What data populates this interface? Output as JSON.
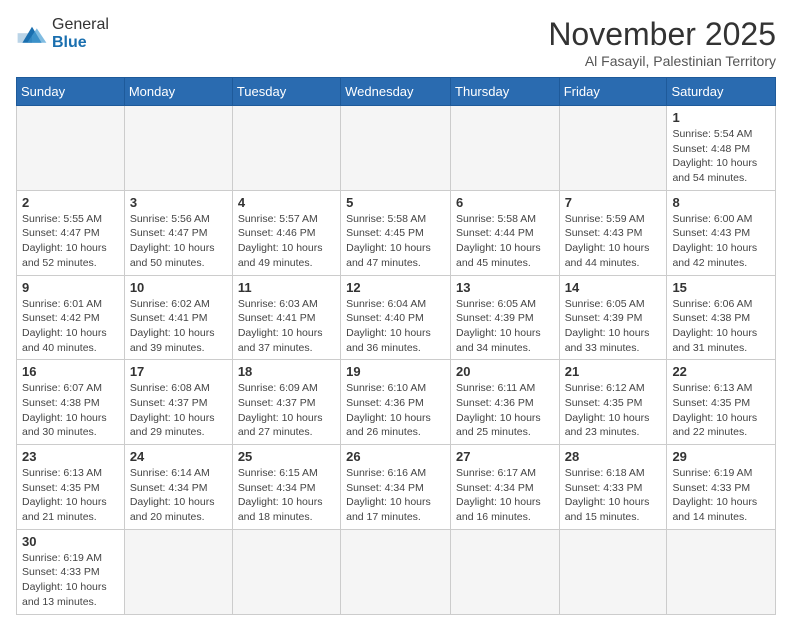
{
  "header": {
    "logo_general": "General",
    "logo_blue": "Blue",
    "month_title": "November 2025",
    "subtitle": "Al Fasayil, Palestinian Territory"
  },
  "weekdays": [
    "Sunday",
    "Monday",
    "Tuesday",
    "Wednesday",
    "Thursday",
    "Friday",
    "Saturday"
  ],
  "days": {
    "d1": {
      "n": "1",
      "info": "Sunrise: 5:54 AM\nSunset: 4:48 PM\nDaylight: 10 hours\nand 54 minutes."
    },
    "d2": {
      "n": "2",
      "info": "Sunrise: 5:55 AM\nSunset: 4:47 PM\nDaylight: 10 hours\nand 52 minutes."
    },
    "d3": {
      "n": "3",
      "info": "Sunrise: 5:56 AM\nSunset: 4:47 PM\nDaylight: 10 hours\nand 50 minutes."
    },
    "d4": {
      "n": "4",
      "info": "Sunrise: 5:57 AM\nSunset: 4:46 PM\nDaylight: 10 hours\nand 49 minutes."
    },
    "d5": {
      "n": "5",
      "info": "Sunrise: 5:58 AM\nSunset: 4:45 PM\nDaylight: 10 hours\nand 47 minutes."
    },
    "d6": {
      "n": "6",
      "info": "Sunrise: 5:58 AM\nSunset: 4:44 PM\nDaylight: 10 hours\nand 45 minutes."
    },
    "d7": {
      "n": "7",
      "info": "Sunrise: 5:59 AM\nSunset: 4:43 PM\nDaylight: 10 hours\nand 44 minutes."
    },
    "d8": {
      "n": "8",
      "info": "Sunrise: 6:00 AM\nSunset: 4:43 PM\nDaylight: 10 hours\nand 42 minutes."
    },
    "d9": {
      "n": "9",
      "info": "Sunrise: 6:01 AM\nSunset: 4:42 PM\nDaylight: 10 hours\nand 40 minutes."
    },
    "d10": {
      "n": "10",
      "info": "Sunrise: 6:02 AM\nSunset: 4:41 PM\nDaylight: 10 hours\nand 39 minutes."
    },
    "d11": {
      "n": "11",
      "info": "Sunrise: 6:03 AM\nSunset: 4:41 PM\nDaylight: 10 hours\nand 37 minutes."
    },
    "d12": {
      "n": "12",
      "info": "Sunrise: 6:04 AM\nSunset: 4:40 PM\nDaylight: 10 hours\nand 36 minutes."
    },
    "d13": {
      "n": "13",
      "info": "Sunrise: 6:05 AM\nSunset: 4:39 PM\nDaylight: 10 hours\nand 34 minutes."
    },
    "d14": {
      "n": "14",
      "info": "Sunrise: 6:05 AM\nSunset: 4:39 PM\nDaylight: 10 hours\nand 33 minutes."
    },
    "d15": {
      "n": "15",
      "info": "Sunrise: 6:06 AM\nSunset: 4:38 PM\nDaylight: 10 hours\nand 31 minutes."
    },
    "d16": {
      "n": "16",
      "info": "Sunrise: 6:07 AM\nSunset: 4:38 PM\nDaylight: 10 hours\nand 30 minutes."
    },
    "d17": {
      "n": "17",
      "info": "Sunrise: 6:08 AM\nSunset: 4:37 PM\nDaylight: 10 hours\nand 29 minutes."
    },
    "d18": {
      "n": "18",
      "info": "Sunrise: 6:09 AM\nSunset: 4:37 PM\nDaylight: 10 hours\nand 27 minutes."
    },
    "d19": {
      "n": "19",
      "info": "Sunrise: 6:10 AM\nSunset: 4:36 PM\nDaylight: 10 hours\nand 26 minutes."
    },
    "d20": {
      "n": "20",
      "info": "Sunrise: 6:11 AM\nSunset: 4:36 PM\nDaylight: 10 hours\nand 25 minutes."
    },
    "d21": {
      "n": "21",
      "info": "Sunrise: 6:12 AM\nSunset: 4:35 PM\nDaylight: 10 hours\nand 23 minutes."
    },
    "d22": {
      "n": "22",
      "info": "Sunrise: 6:13 AM\nSunset: 4:35 PM\nDaylight: 10 hours\nand 22 minutes."
    },
    "d23": {
      "n": "23",
      "info": "Sunrise: 6:13 AM\nSunset: 4:35 PM\nDaylight: 10 hours\nand 21 minutes."
    },
    "d24": {
      "n": "24",
      "info": "Sunrise: 6:14 AM\nSunset: 4:34 PM\nDaylight: 10 hours\nand 20 minutes."
    },
    "d25": {
      "n": "25",
      "info": "Sunrise: 6:15 AM\nSunset: 4:34 PM\nDaylight: 10 hours\nand 18 minutes."
    },
    "d26": {
      "n": "26",
      "info": "Sunrise: 6:16 AM\nSunset: 4:34 PM\nDaylight: 10 hours\nand 17 minutes."
    },
    "d27": {
      "n": "27",
      "info": "Sunrise: 6:17 AM\nSunset: 4:34 PM\nDaylight: 10 hours\nand 16 minutes."
    },
    "d28": {
      "n": "28",
      "info": "Sunrise: 6:18 AM\nSunset: 4:33 PM\nDaylight: 10 hours\nand 15 minutes."
    },
    "d29": {
      "n": "29",
      "info": "Sunrise: 6:19 AM\nSunset: 4:33 PM\nDaylight: 10 hours\nand 14 minutes."
    },
    "d30": {
      "n": "30",
      "info": "Sunrise: 6:19 AM\nSunset: 4:33 PM\nDaylight: 10 hours\nand 13 minutes."
    }
  }
}
